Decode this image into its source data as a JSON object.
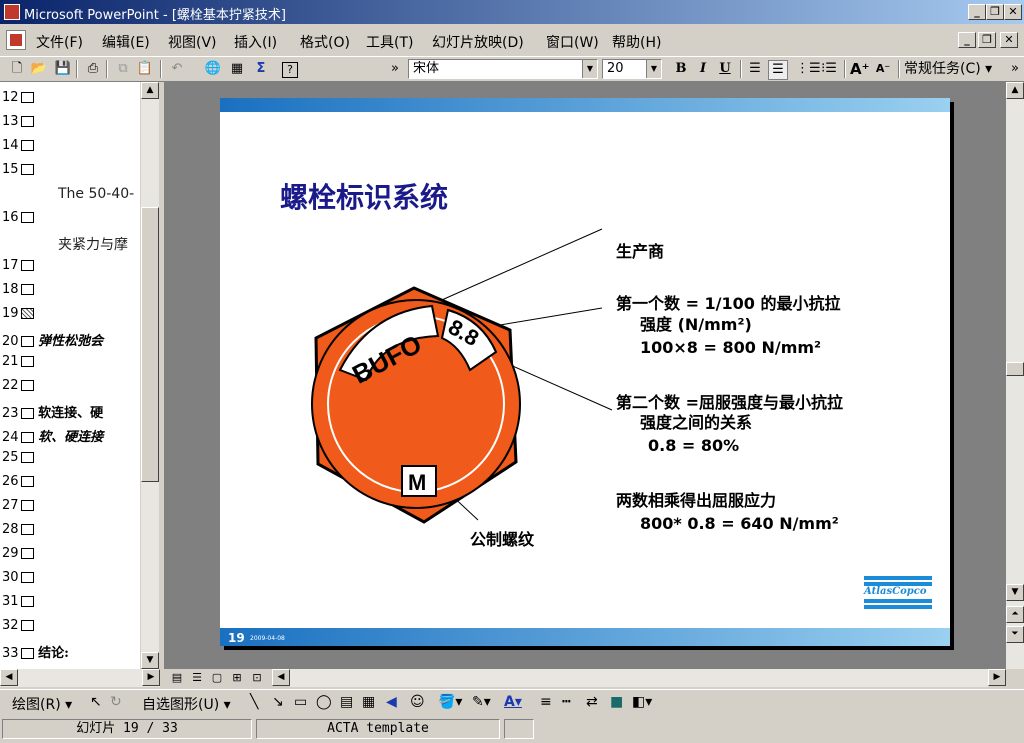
{
  "window": {
    "title": "Microsoft PowerPoint - [螺栓基本拧紧技术]"
  },
  "menu": {
    "items": [
      "文件(F)",
      "编辑(E)",
      "视图(V)",
      "插入(I)",
      "格式(O)",
      "工具(T)",
      "幻灯片放映(D)",
      "窗口(W)",
      "帮助(H)"
    ]
  },
  "toolbar": {
    "font_name": "宋体",
    "font_size": "20",
    "bold_label": "B",
    "italic_label": "I",
    "underline_label": "U",
    "task_pane": "常规任务(C)"
  },
  "outline": {
    "rows": [
      {
        "num": "12",
        "text": ""
      },
      {
        "num": "13",
        "text": ""
      },
      {
        "num": "14",
        "text": ""
      },
      {
        "num": "15",
        "text": ""
      },
      {
        "num": "16",
        "text": ""
      },
      {
        "num": "17",
        "text": ""
      },
      {
        "num": "18",
        "text": ""
      },
      {
        "num": "19",
        "text": ""
      },
      {
        "num": "20",
        "text": "弹性松弛会"
      },
      {
        "num": "21",
        "text": ""
      },
      {
        "num": "22",
        "text": ""
      },
      {
        "num": "23",
        "text": "软连接、硬"
      },
      {
        "num": "24",
        "text": "软、硬连接"
      },
      {
        "num": "25",
        "text": ""
      },
      {
        "num": "26",
        "text": ""
      },
      {
        "num": "27",
        "text": ""
      },
      {
        "num": "28",
        "text": ""
      },
      {
        "num": "29",
        "text": ""
      },
      {
        "num": "30",
        "text": ""
      },
      {
        "num": "31",
        "text": ""
      },
      {
        "num": "32",
        "text": ""
      },
      {
        "num": "33",
        "text": "结论:"
      }
    ],
    "sub_15": "The 50-40-",
    "sub_16": "夹紧力与摩"
  },
  "slide": {
    "title": "螺栓标识系统",
    "manufacturer": "生产商",
    "first_num_line1": "第一个数 = 1/100 的最小抗拉",
    "first_num_line2": "强度 (N/mm²)",
    "first_num_example": "100×8 = 800 N/mm²",
    "second_num_line1": "第二个数 =屈服强度与最小抗拉",
    "second_num_line2": "强度之间的关系",
    "second_num_example": "0.8 = 80%",
    "product_line": "两数相乘得出屈服应力",
    "product_example": "800* 0.8 = 640 N/mm²",
    "metric_thread": "公制螺纹",
    "bolt_brand": "BUFO",
    "bolt_grade": "8.8",
    "bolt_metric": "M",
    "page_number": "19",
    "date": "2009-04-08",
    "logo_line1": "Atlas",
    "logo_line2": "Copco",
    "bolt_color": "#f05a1a"
  },
  "drawbar": {
    "draw_label": "绘图(R)",
    "autoshapes_label": "自选图形(U)"
  },
  "status": {
    "slide_pos": "幻灯片 19 / 33",
    "template": "ACTA template"
  }
}
